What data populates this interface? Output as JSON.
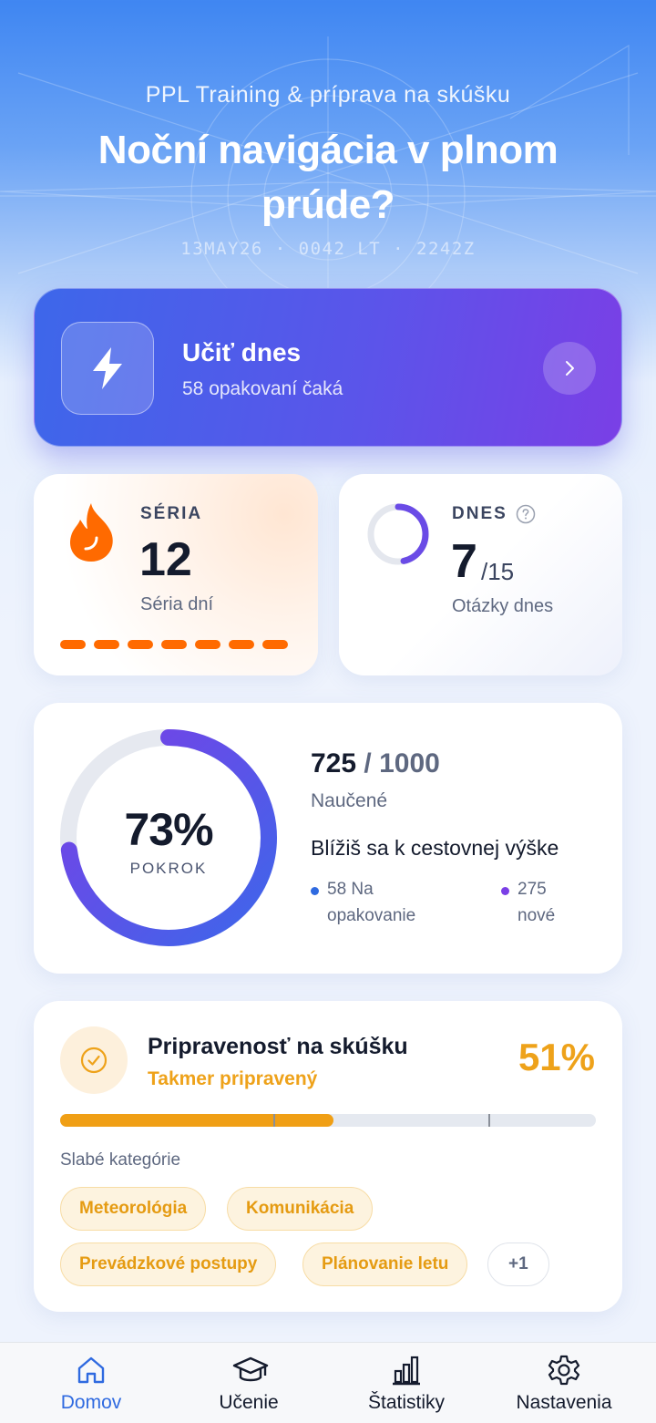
{
  "header": {
    "subtitle": "PPL Training & príprava na skúšku",
    "title": "Noční navigácia v plnom prúde?",
    "timestamp": "13MAY26 · 0042 LT · 2242Z"
  },
  "cta": {
    "title": "Učiť dnes",
    "subtitle": "58 opakovaní čaká",
    "icon": "lightning-icon",
    "arrow_icon": "chevron-right-icon"
  },
  "streak": {
    "label": "SÉRIA",
    "value": "12",
    "caption": "Séria dní",
    "icon": "flame-icon",
    "days_marked": 7
  },
  "today": {
    "label": "DNES",
    "value": "7",
    "total": "/15",
    "caption": "Otázky dnes",
    "progress_fraction": 0.4667,
    "help_icon": "question-circle-icon"
  },
  "progress": {
    "percent_text": "73%",
    "percent": 73,
    "ring_label": "POKROK",
    "learned": "725",
    "total": "/ 1000",
    "learned_label": "Naučené",
    "message": "Blížiš sa k cestovnej výške",
    "legend": [
      {
        "line1": "58 Na",
        "line2": "opakovanie",
        "color": "#2f6ae0"
      },
      {
        "line1": "275",
        "line2": "nové",
        "color": "#7a3fe6"
      }
    ]
  },
  "readiness": {
    "title": "Pripravenosť na skúšku",
    "status": "Takmer pripravený",
    "percent_text": "51%",
    "percent": 51,
    "weak_label": "Slabé kategórie",
    "chips": [
      "Meteorológia",
      "Komunikácia",
      "Prevádzkové postupy",
      "Plánovanie letu"
    ],
    "more": "+1",
    "accent": "#eea21a"
  },
  "tabs": [
    {
      "label": "Domov",
      "icon": "home-icon",
      "active": true
    },
    {
      "label": "Učenie",
      "icon": "graduation-cap-icon",
      "active": false
    },
    {
      "label": "Štatistiky",
      "icon": "bar-chart-icon",
      "active": false
    },
    {
      "label": "Nastavenia",
      "icon": "gear-icon",
      "active": false
    }
  ]
}
